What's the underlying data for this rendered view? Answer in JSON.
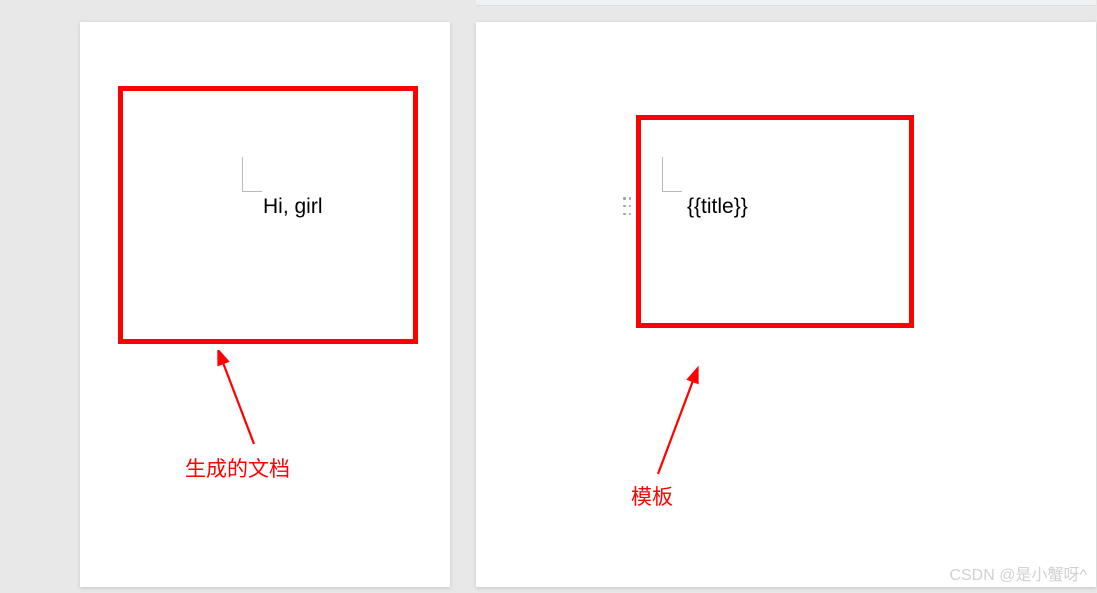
{
  "left_doc": {
    "content_text": "Hi, girl",
    "annotation_label": "生成的文档"
  },
  "right_doc": {
    "content_text": "{{title}}",
    "annotation_label": "模板"
  },
  "watermark": "CSDN @是小蟹呀^"
}
